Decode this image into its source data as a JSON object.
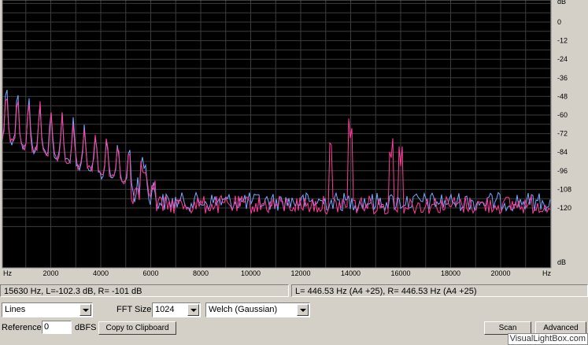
{
  "plot": {
    "db_unit": "dB",
    "db_ticks": [
      "0",
      "-12",
      "-24",
      "-36",
      "-48",
      "-60",
      "-72",
      "-84",
      "-96",
      "-108",
      "-120"
    ],
    "db_bottom_unit": "dB",
    "hz_left": "Hz",
    "hz_right": "Hz",
    "hz_ticks": [
      "2000",
      "4000",
      "6000",
      "8000",
      "10000",
      "12000",
      "14000",
      "16000",
      "18000",
      "20000"
    ],
    "colors": {
      "background": "#000000",
      "grid": "#3c3c3c",
      "left_channel": "#ff3c9c",
      "right_channel": "#78a8ff"
    }
  },
  "status": {
    "cursor_readout": "15630 Hz, L=-102.3 dB, R=  -101 dB",
    "peak_readout": "L= 446.53 Hz (A4 +25), R= 446.53 Hz (A4 +25)"
  },
  "controls": {
    "display_mode": "Lines",
    "fft_size_label": "FFT Size",
    "fft_size": "1024",
    "window": "Welch (Gaussian)",
    "reference_label": "Reference",
    "reference_value": "0",
    "dbfs_label": "dBFS",
    "copy_button": "Copy to Clipboard",
    "scan_button": "Scan",
    "advanced_button": "Advanced"
  },
  "watermark": "VisualLightBox.com"
}
